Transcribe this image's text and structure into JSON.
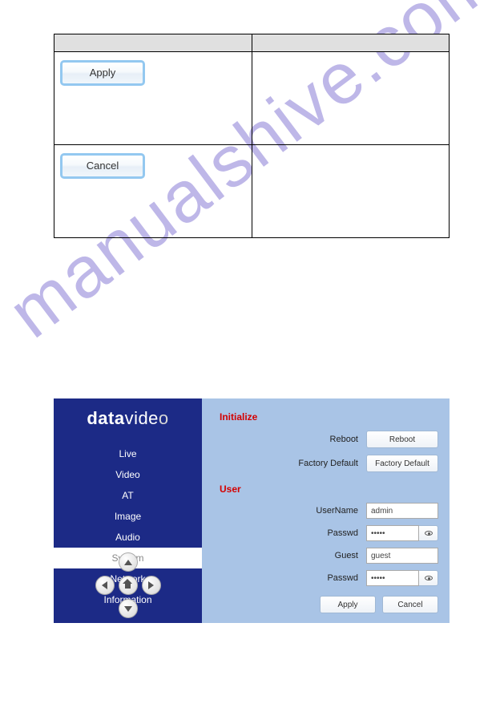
{
  "watermark": "manualshive.com",
  "top_table": {
    "apply_label": "Apply",
    "cancel_label": "Cancel"
  },
  "sidebar": {
    "logo_prefix": "data",
    "logo_suffix": "vide",
    "logo_oe": "o",
    "nav": [
      {
        "label": "Live",
        "active": false
      },
      {
        "label": "Video",
        "active": false
      },
      {
        "label": "AT",
        "active": false
      },
      {
        "label": "Image",
        "active": false
      },
      {
        "label": "Audio",
        "active": false
      },
      {
        "label": "System",
        "active": true
      },
      {
        "label": "Network",
        "active": false
      },
      {
        "label": "Information",
        "active": false
      }
    ]
  },
  "content": {
    "initialize": {
      "title": "Initialize",
      "reboot_label": "Reboot",
      "reboot_btn": "Reboot",
      "factory_label": "Factory Default",
      "factory_btn": "Factory Default"
    },
    "user": {
      "title": "User",
      "username_label": "UserName",
      "username_value": "admin",
      "passwd1_label": "Passwd",
      "passwd1_value": "•••••",
      "guest_label": "Guest",
      "guest_value": "guest",
      "passwd2_label": "Passwd",
      "passwd2_value": "•••••"
    },
    "actions": {
      "apply": "Apply",
      "cancel": "Cancel"
    }
  }
}
